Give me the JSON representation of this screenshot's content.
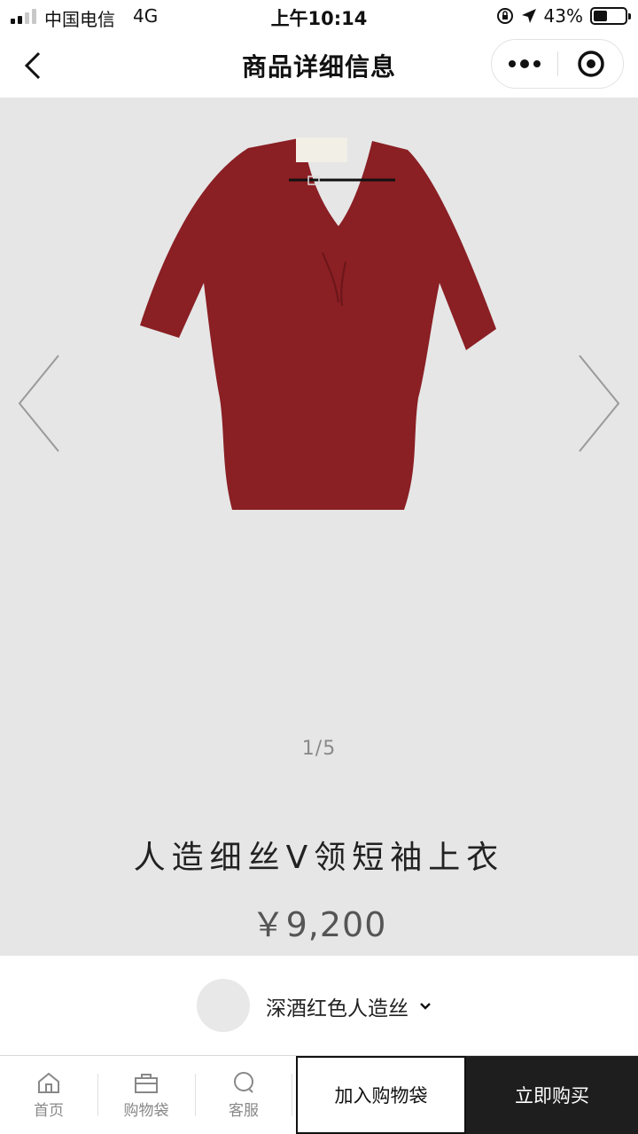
{
  "status_bar": {
    "carrier": "中国电信",
    "network": "4G",
    "time": "上午10:14",
    "battery_text": "43%",
    "battery_level": 0.43
  },
  "nav": {
    "title": "商品详细信息",
    "icons": [
      "back-icon",
      "more-icon",
      "close-icon"
    ]
  },
  "product": {
    "color_hex": "#8a1f24",
    "pager": "1/5",
    "name": "人造细丝V领短袖上衣",
    "price": "￥9,200"
  },
  "variant": {
    "label": "深酒红色人造丝"
  },
  "bottom_bar": {
    "tabs": [
      {
        "label": "首页",
        "icon": "home-icon"
      },
      {
        "label": "购物袋",
        "icon": "bag-icon"
      },
      {
        "label": "客服",
        "icon": "chat-icon"
      }
    ],
    "add_to_bag": "加入购物袋",
    "buy_now": "立即购买"
  }
}
